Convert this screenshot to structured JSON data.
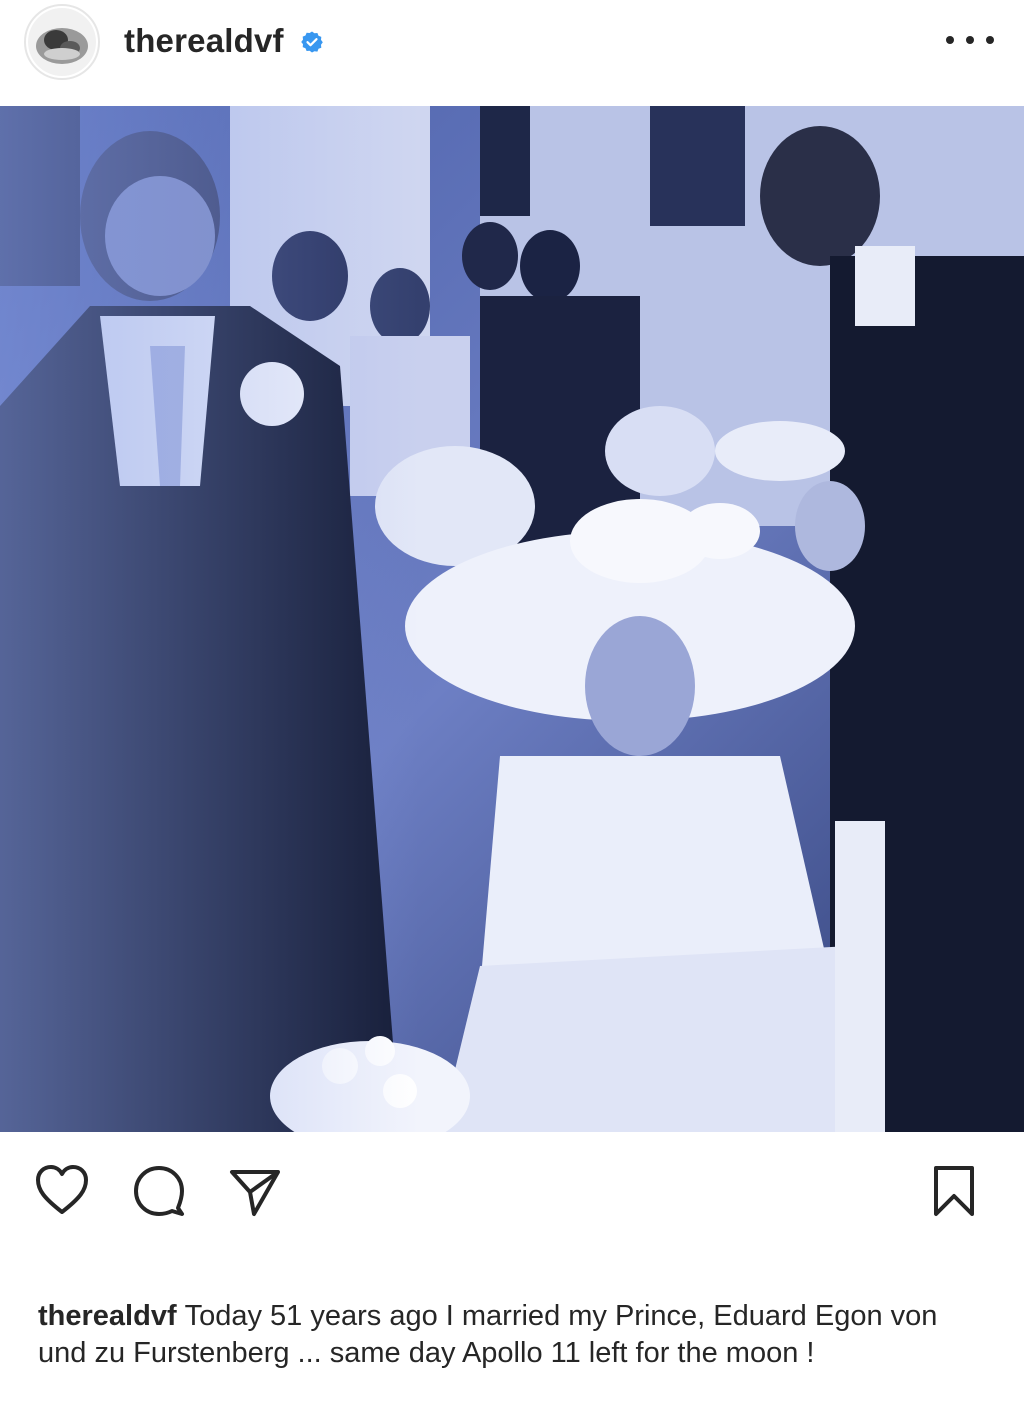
{
  "post": {
    "header": {
      "username": "therealdvf",
      "verified": true,
      "avatar_icon": "profile-avatar",
      "more_icon": "more-options-icon"
    },
    "photo": {
      "style": "black-and-white wedding photograph with blue tint",
      "tint_color": "#2a3a66"
    },
    "actions": {
      "icons": [
        "heart-icon",
        "comment-icon",
        "share-icon",
        "bookmark-icon"
      ]
    },
    "caption": {
      "username": "therealdvf",
      "text": "Today 51 years ago I married my Prince, Eduard Egon von und zu Furstenberg ... same day Apollo 11 left for the moon !"
    },
    "colors": {
      "text": "#262626",
      "verified_badge": "#3897f0",
      "background": "#ffffff"
    }
  }
}
